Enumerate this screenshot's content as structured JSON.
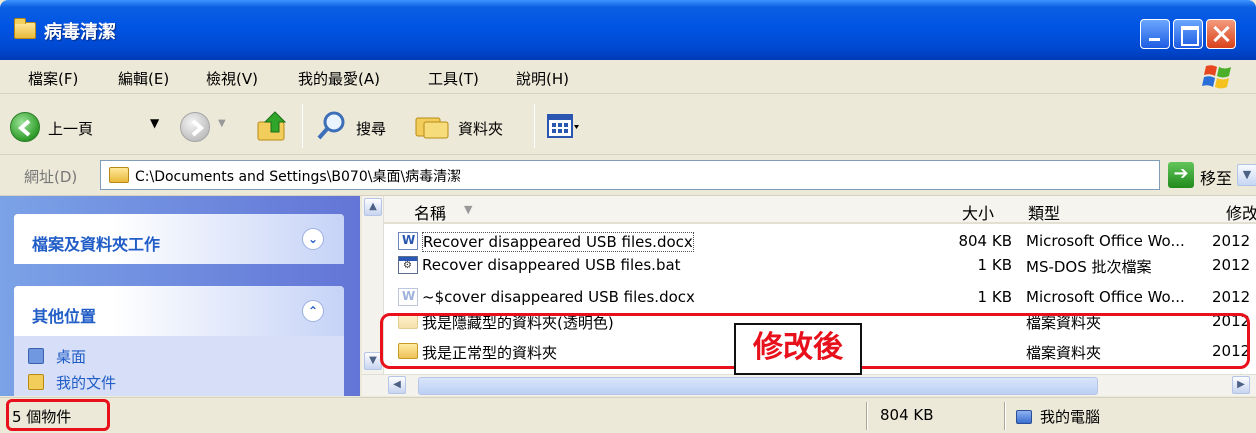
{
  "window": {
    "title": "病毒清潔",
    "folder_icon": "folder-icon"
  },
  "menu": [
    "檔案(F)",
    "編輯(E)",
    "檢視(V)",
    "我的最愛(A)",
    "工具(T)",
    "說明(H)"
  ],
  "toolbar": {
    "back_label": "上一頁",
    "search_label": "搜尋",
    "folders_label": "資料夾"
  },
  "address": {
    "label": "網址(D)",
    "path": "C:\\Documents and Settings\\B070\\桌面\\病毒清潔",
    "go_label": "移至"
  },
  "left_pane": {
    "panel1_title": "檔案及資料夾工作",
    "panel2_title": "其他位置",
    "places": [
      "桌面",
      "我的文件"
    ]
  },
  "columns": {
    "name": "名稱",
    "size": "大小",
    "type": "類型",
    "modified": "修改"
  },
  "files": [
    {
      "name": "Recover disappeared USB files.docx",
      "size": "804 KB",
      "type": "Microsoft Office Wo...",
      "modified": "2012",
      "icon": "word-doc-icon"
    },
    {
      "name": "Recover disappeared USB files.bat",
      "size": "1 KB",
      "type": "MS-DOS 批次檔案",
      "modified": "2012",
      "icon": "batch-file-icon"
    },
    {
      "name": "~$cover disappeared USB files.docx",
      "size": "1 KB",
      "type": "Microsoft Office Wo...",
      "modified": "2012",
      "icon": "word-doc-icon"
    },
    {
      "name": "我是隱藏型的資料夾(透明色)",
      "size": "",
      "type": "檔案資料夾",
      "modified": "2012",
      "icon": "folder-icon"
    },
    {
      "name": "我是正常型的資料夾",
      "size": "",
      "type": "檔案資料夾",
      "modified": "2012",
      "icon": "folder-icon"
    }
  ],
  "status": {
    "count": "5 個物件",
    "size": "804 KB",
    "location": "我的電腦"
  },
  "annotation": {
    "label": "修改後",
    "color": "#e8101b"
  }
}
